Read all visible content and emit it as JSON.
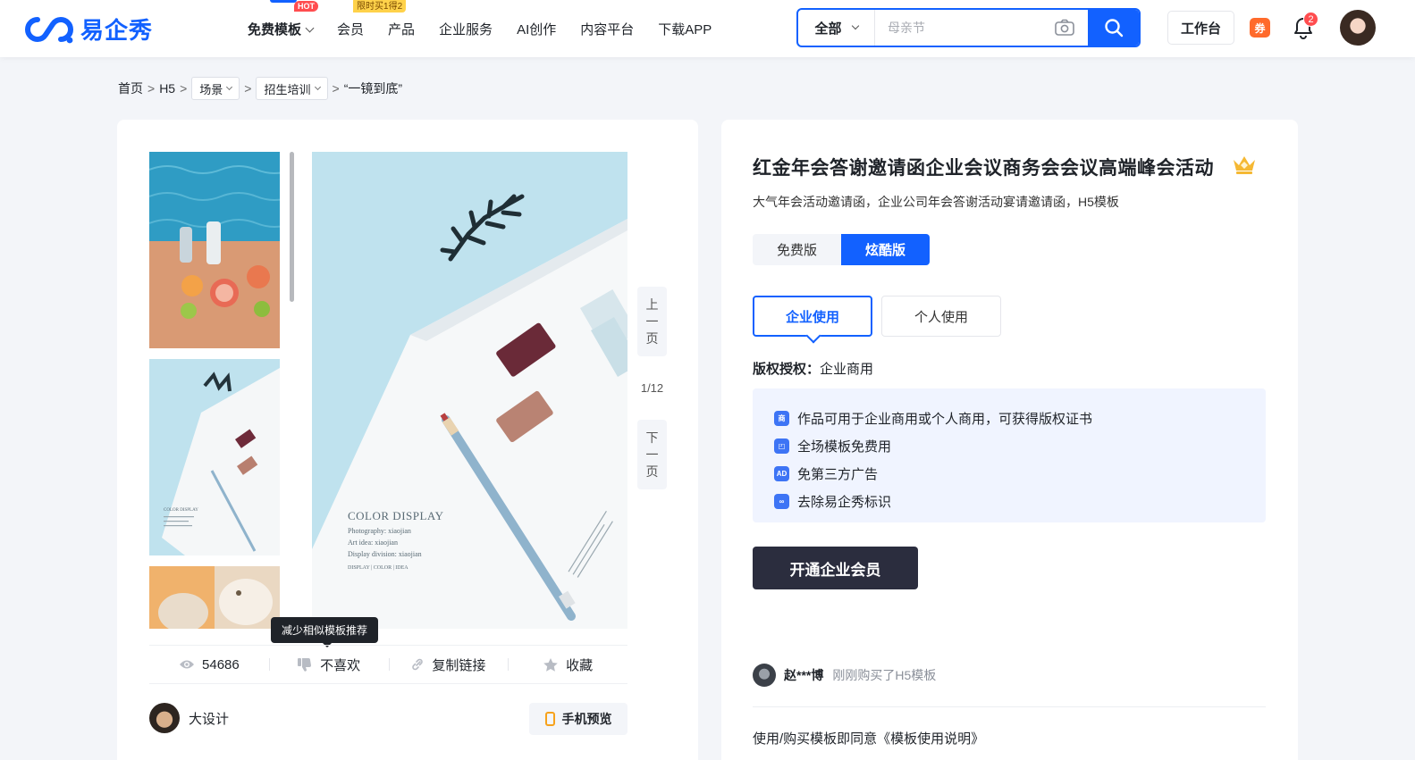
{
  "brand": {
    "name": "易企秀",
    "accent": "#1261ff"
  },
  "nav": {
    "items": [
      {
        "label": "免费模板",
        "badge": "HOT"
      },
      {
        "label": "会员",
        "badge": "限时买1得2"
      },
      {
        "label": "产品"
      },
      {
        "label": "企业服务"
      },
      {
        "label": "AI创作"
      },
      {
        "label": "内容平台"
      },
      {
        "label": "下载APP"
      }
    ]
  },
  "search": {
    "category": "全部",
    "placeholder": "母亲节"
  },
  "header": {
    "workbench": "工作台",
    "coupon": "券",
    "notifications": "2"
  },
  "breadcrumb": {
    "home": "首页",
    "h5": "H5",
    "scene": "场景",
    "category": "招生培训",
    "current": "“一镜到底”",
    "sep": ">"
  },
  "preview": {
    "page_indicator": "1/12",
    "prev": [
      "上",
      "一",
      "页"
    ],
    "next": [
      "下",
      "一",
      "页"
    ],
    "poster": {
      "title": "COLOR DISPLAY",
      "lines": [
        "Photography:  xiaojian",
        "Art idea:  xiaojian",
        "Display division:  xiaojian"
      ],
      "tags": "DISPLAY | COLOR | IDEA"
    },
    "thumb_poster": {
      "title": "COLOR DISPLAY"
    }
  },
  "tooltip": "减少相似模板推荐",
  "actions": {
    "views": "54686",
    "dislike": "不喜欢",
    "copy_link": "复制链接",
    "favorite": "收藏"
  },
  "author": {
    "name": "大设计"
  },
  "mobile_preview": "手机预览",
  "detail": {
    "title": "红金年会答谢邀请函企业会议商务会会议高端峰会活动",
    "subtitle": "大气年会活动邀请函，企业公司年会答谢活动宴请邀请函，H5模板",
    "editions": {
      "free": "免费版",
      "cool": "炫酷版"
    },
    "usage": {
      "enterprise": "企业使用",
      "personal": "个人使用"
    },
    "license_label": "版权授权：",
    "license_value": "企业商用",
    "benefits": [
      {
        "icon": "商",
        "text": "作品可用于企业商用或个人商用，可获得版权证书"
      },
      {
        "icon": "◰",
        "text": "全场模板免费用"
      },
      {
        "icon": "AD",
        "text": "免第三方广告"
      },
      {
        "icon": "∞",
        "text": "去除易企秀标识"
      }
    ],
    "cta": "开通企业会员",
    "buyer": {
      "name": "赵***博",
      "action": "刚刚购买了H5模板"
    },
    "agreement": "使用/购买模板即同意《模板使用说明》"
  }
}
